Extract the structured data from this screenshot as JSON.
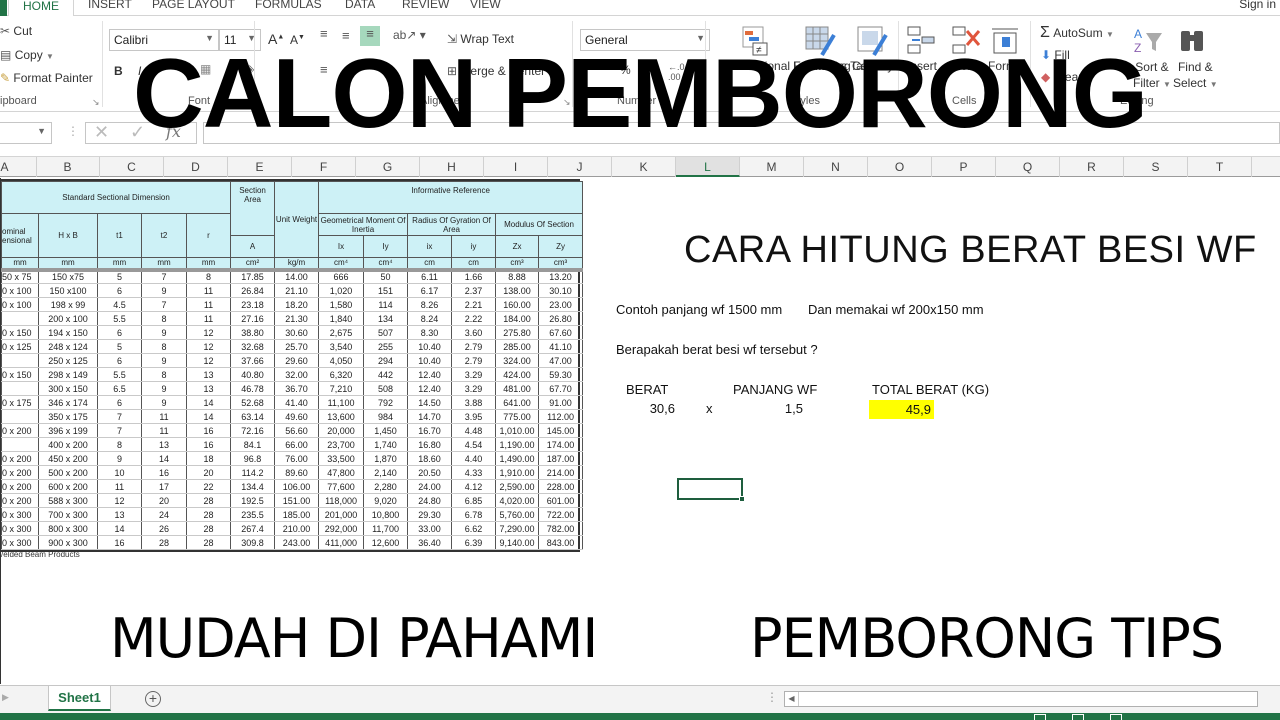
{
  "ribbon_tabs": [
    "HOME",
    "INSERT",
    "PAGE LAYOUT",
    "FORMULAS",
    "DATA",
    "REVIEW",
    "VIEW"
  ],
  "active_tab": "HOME",
  "sign_in": "Sign in",
  "clipboard": {
    "cut": "Cut",
    "copy": "Copy",
    "format_painter": "Format Painter",
    "group": "Clipboard"
  },
  "font": {
    "name": "Calibri",
    "size": "11",
    "bold": "B",
    "italic": "I",
    "group": "Font"
  },
  "alignment": {
    "wrap_text": "Wrap Text",
    "merge_center": "Merge & Center",
    "group": "Alignment"
  },
  "number": {
    "format": "General",
    "group": "Number",
    "percent": "%"
  },
  "styles": {
    "conditional_formatting": "Conditional Formatting",
    "format_as_table": "Format as Table",
    "cell_styles": "Cell Styles",
    "group": "Styles"
  },
  "cells": {
    "insert": "Insert",
    "delete": "Delete",
    "format": "Format",
    "group": "Cells"
  },
  "editing": {
    "autosum": "AutoSum",
    "fill": "Fill",
    "clear": "Clear",
    "sort_filter_1": "Sort &",
    "sort_filter_2": "Filter",
    "find_select_1": "Find &",
    "find_select_2": "Select",
    "group": "Editing"
  },
  "formula_bar": {
    "name_box": "",
    "fx": "fx",
    "cancel": "✕",
    "enter": "✓",
    "value": ""
  },
  "columns": [
    "A",
    "B",
    "C",
    "D",
    "E",
    "F",
    "G",
    "H",
    "I",
    "J",
    "K",
    "L",
    "M",
    "N",
    "O",
    "P",
    "Q",
    "R",
    "S",
    "T"
  ],
  "selected_column": "L",
  "wf_table": {
    "header_group_1": "Standard Sectional Dimension",
    "header_section_area": "Section Area",
    "header_unit_weight": "Unit Weight",
    "header_informative": "Informative Reference",
    "header_geom": "Geometrical Moment Of Inertia",
    "header_radius": "Radius Of Gyration Of Area",
    "header_modulus": "Modulus Of Section",
    "sub_headers": [
      "ominal ensional",
      "H x B",
      "t1",
      "t2",
      "r",
      "A",
      "",
      "Ix",
      "Iy",
      "ix",
      "iy",
      "Zx",
      "Zy"
    ],
    "units": [
      "mm",
      "mm",
      "mm",
      "mm",
      "mm",
      "cm²",
      "kg/m",
      "cm⁴",
      "cm⁴",
      "cm",
      "cm",
      "cm³",
      "cm³"
    ],
    "rows": [
      {
        "nominal": "50 x 75",
        "hxb": "150 x75",
        "t1": "5",
        "t2": "7",
        "r": "8",
        "A": "17.85",
        "W": "14.00",
        "Ix": "666",
        "Iy": "50",
        "ix": "6.11",
        "iy": "1.66",
        "Zx": "8.88",
        "Zy": "13.20",
        "grp": true
      },
      {
        "nominal": "0 x 100",
        "hxb": "150 x100",
        "t1": "6",
        "t2": "9",
        "r": "11",
        "A": "26.84",
        "W": "21.10",
        "Ix": "1,020",
        "Iy": "151",
        "ix": "6.17",
        "iy": "2.37",
        "Zx": "138.00",
        "Zy": "30.10",
        "grp": true
      },
      {
        "nominal": "0 x 100",
        "hxb": "198 x 99",
        "t1": "4.5",
        "t2": "7",
        "r": "11",
        "A": "23.18",
        "W": "18.20",
        "Ix": "1,580",
        "Iy": "114",
        "ix": "8.26",
        "iy": "2.21",
        "Zx": "160.00",
        "Zy": "23.00",
        "grp": true
      },
      {
        "nominal": "",
        "hxb": "200 x 100",
        "t1": "5.5",
        "t2": "8",
        "r": "11",
        "A": "27.16",
        "W": "21.30",
        "Ix": "1,840",
        "Iy": "134",
        "ix": "8.24",
        "iy": "2.22",
        "Zx": "184.00",
        "Zy": "26.80",
        "grp": false
      },
      {
        "nominal": "0 x 150",
        "hxb": "194 x 150",
        "t1": "6",
        "t2": "9",
        "r": "12",
        "A": "38.80",
        "W": "30.60",
        "Ix": "2,675",
        "Iy": "507",
        "ix": "8.30",
        "iy": "3.60",
        "Zx": "275.80",
        "Zy": "67.60",
        "grp": true
      },
      {
        "nominal": "0 x 125",
        "hxb": "248 x 124",
        "t1": "5",
        "t2": "8",
        "r": "12",
        "A": "32.68",
        "W": "25.70",
        "Ix": "3,540",
        "Iy": "255",
        "ix": "10.40",
        "iy": "2.79",
        "Zx": "285.00",
        "Zy": "41.10",
        "grp": true
      },
      {
        "nominal": "",
        "hxb": "250 x 125",
        "t1": "6",
        "t2": "9",
        "r": "12",
        "A": "37.66",
        "W": "29.60",
        "Ix": "4,050",
        "Iy": "294",
        "ix": "10.40",
        "iy": "2.79",
        "Zx": "324.00",
        "Zy": "47.00",
        "grp": false
      },
      {
        "nominal": "0 x 150",
        "hxb": "298 x 149",
        "t1": "5.5",
        "t2": "8",
        "r": "13",
        "A": "40.80",
        "W": "32.00",
        "Ix": "6,320",
        "Iy": "442",
        "ix": "12.40",
        "iy": "3.29",
        "Zx": "424.00",
        "Zy": "59.30",
        "grp": true
      },
      {
        "nominal": "",
        "hxb": "300 x 150",
        "t1": "6.5",
        "t2": "9",
        "r": "13",
        "A": "46.78",
        "W": "36.70",
        "Ix": "7,210",
        "Iy": "508",
        "ix": "12.40",
        "iy": "3.29",
        "Zx": "481.00",
        "Zy": "67.70",
        "grp": false
      },
      {
        "nominal": "0 x 175",
        "hxb": "346 x 174",
        "t1": "6",
        "t2": "9",
        "r": "14",
        "A": "52.68",
        "W": "41.40",
        "Ix": "11,100",
        "Iy": "792",
        "ix": "14.50",
        "iy": "3.88",
        "Zx": "641.00",
        "Zy": "91.00",
        "grp": true
      },
      {
        "nominal": "",
        "hxb": "350 x 175",
        "t1": "7",
        "t2": "11",
        "r": "14",
        "A": "63.14",
        "W": "49.60",
        "Ix": "13,600",
        "Iy": "984",
        "ix": "14.70",
        "iy": "3.95",
        "Zx": "775.00",
        "Zy": "112.00",
        "grp": false
      },
      {
        "nominal": "0 x 200",
        "hxb": "396 x 199",
        "t1": "7",
        "t2": "11",
        "r": "16",
        "A": "72.16",
        "W": "56.60",
        "Ix": "20,000",
        "Iy": "1,450",
        "ix": "16.70",
        "iy": "4.48",
        "Zx": "1,010.00",
        "Zy": "145.00",
        "grp": true
      },
      {
        "nominal": "",
        "hxb": "400 x 200",
        "t1": "8",
        "t2": "13",
        "r": "16",
        "A": "84.1",
        "W": "66.00",
        "Ix": "23,700",
        "Iy": "1,740",
        "ix": "16.80",
        "iy": "4.54",
        "Zx": "1,190.00",
        "Zy": "174.00",
        "grp": false
      },
      {
        "nominal": "0 x 200",
        "hxb": "450 x 200",
        "t1": "9",
        "t2": "14",
        "r": "18",
        "A": "96.8",
        "W": "76.00",
        "Ix": "33,500",
        "Iy": "1,870",
        "ix": "18.60",
        "iy": "4.40",
        "Zx": "1,490.00",
        "Zy": "187.00",
        "grp": true
      },
      {
        "nominal": "0 x 200",
        "hxb": "500 x 200",
        "t1": "10",
        "t2": "16",
        "r": "20",
        "A": "114.2",
        "W": "89.60",
        "Ix": "47,800",
        "Iy": "2,140",
        "ix": "20.50",
        "iy": "4.33",
        "Zx": "1,910.00",
        "Zy": "214.00",
        "grp": true
      },
      {
        "nominal": "0 x 200",
        "hxb": "600 x 200",
        "t1": "11",
        "t2": "17",
        "r": "22",
        "A": "134.4",
        "W": "106.00",
        "Ix": "77,600",
        "Iy": "2,280",
        "ix": "24.00",
        "iy": "4.12",
        "Zx": "2,590.00",
        "Zy": "228.00",
        "grp": true
      },
      {
        "nominal": "0 x 200",
        "hxb": "588 x 300",
        "t1": "12",
        "t2": "20",
        "r": "28",
        "A": "192.5",
        "W": "151.00",
        "Ix": "118,000",
        "Iy": "9,020",
        "ix": "24.80",
        "iy": "6.85",
        "Zx": "4,020.00",
        "Zy": "601.00",
        "grp": true
      },
      {
        "nominal": "0 x 300",
        "hxb": "700 x 300",
        "t1": "13",
        "t2": "24",
        "r": "28",
        "A": "235.5",
        "W": "185.00",
        "Ix": "201,000",
        "Iy": "10,800",
        "ix": "29.30",
        "iy": "6.78",
        "Zx": "5,760.00",
        "Zy": "722.00",
        "grp": true
      },
      {
        "nominal": "0 x 300",
        "hxb": "800 x 300",
        "t1": "14",
        "t2": "26",
        "r": "28",
        "A": "267.4",
        "W": "210.00",
        "Ix": "292,000",
        "Iy": "11,700",
        "ix": "33.00",
        "iy": "6.62",
        "Zx": "7,290.00",
        "Zy": "782.00",
        "grp": true
      },
      {
        "nominal": "0 x 300",
        "hxb": "900 x 300",
        "t1": "16",
        "t2": "28",
        "r": "28",
        "A": "309.8",
        "W": "243.00",
        "Ix": "411,000",
        "Iy": "12,600",
        "ix": "36.40",
        "iy": "6.39",
        "Zx": "9,140.00",
        "Zy": "843.00",
        "grp": true
      }
    ],
    "footnote": "/elded Beam Products"
  },
  "content": {
    "title": "CARA HITUNG BERAT BESI WF",
    "contoh": "Contoh panjang wf 1500 mm",
    "dan": "Dan memakai wf 200x150 mm",
    "question": "Berapakah berat besi wf tersebut ?",
    "label_berat": "BERAT",
    "label_panjang": "PANJANG WF",
    "label_total": "TOTAL BERAT (KG)",
    "value_berat": "30,6",
    "operator": "x",
    "value_panjang": "1,5",
    "value_total": "45,9",
    "highlight_color": "#ffff00"
  },
  "overlay": {
    "title": "CALON PEMBORONG",
    "bottom_left": "MUDAH DI PAHAMI",
    "bottom_right": "PEMBORONG TIPS"
  },
  "sheet_tabs": {
    "active": "Sheet1",
    "add": "+"
  },
  "colors": {
    "excel_green": "#217346",
    "table_header": "#cdf1f6"
  }
}
